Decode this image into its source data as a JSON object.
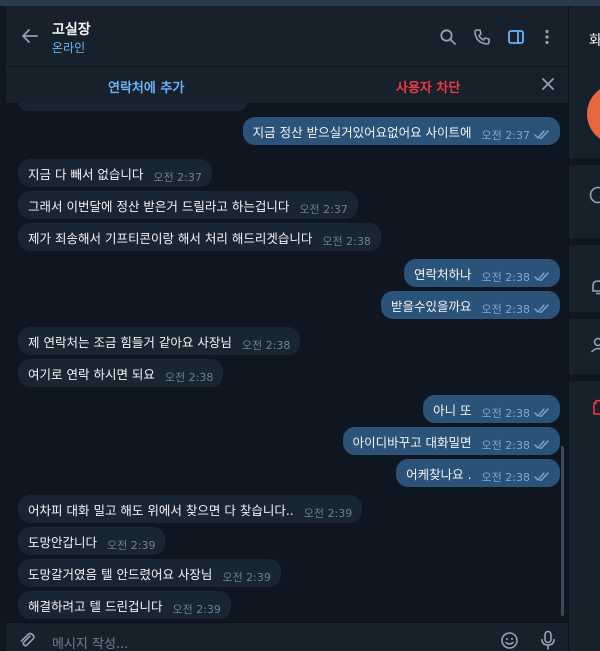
{
  "header": {
    "title": "고실장",
    "status": "온라인"
  },
  "action_bar": {
    "add_contact": "연락처에 추가",
    "block_user": "사용자 차단"
  },
  "messages": [
    {
      "dir": "out",
      "text": "지금 정산 받으실거있어요없어요 사이트에",
      "time": "오전 2:37",
      "read": true
    },
    {
      "dir": "in",
      "text": "지금 다 빼서 없습니다",
      "time": "오전 2:37"
    },
    {
      "dir": "in",
      "text": "그래서 이번달에 정산 받은거 드릴라고 하는겁니다",
      "time": "오전 2:37"
    },
    {
      "dir": "in",
      "text": "제가 죄송해서 기프티콘이랑 해서 처리 해드리겟습니다",
      "time": "오전 2:38"
    },
    {
      "dir": "out",
      "text": "연락처하나",
      "time": "오전 2:38",
      "read": true
    },
    {
      "dir": "out",
      "text": "받을수있을까요",
      "time": "오전 2:38",
      "read": true
    },
    {
      "dir": "in",
      "text": "제 연락처는 조금 힘들거 같아요 사장님",
      "time": "오전 2:38"
    },
    {
      "dir": "in",
      "text": "여기로 연락 하시면 되요",
      "time": "오전 2:38"
    },
    {
      "dir": "out",
      "text": "아니 또",
      "time": "오전 2:38",
      "read": true
    },
    {
      "dir": "out",
      "text": "아이디바꾸고 대화밀면",
      "time": "오전 2:38",
      "read": true
    },
    {
      "dir": "out",
      "text": "어케찾나요 .",
      "time": "오전 2:38",
      "read": true
    },
    {
      "dir": "in",
      "text": "어차피 대화 밀고 해도 위에서 찾으면 다 찾습니다..",
      "time": "오전 2:39"
    },
    {
      "dir": "in",
      "text": "도망안갑니다",
      "time": "오전 2:39"
    },
    {
      "dir": "in",
      "text": "도망갈거였음 텔 안드렸어요 사장님",
      "time": "오전 2:39"
    },
    {
      "dir": "in",
      "text": "해결하려고 텔 드린겁니다",
      "time": "오전 2:39"
    }
  ],
  "input": {
    "placeholder": "메시지 작성..."
  },
  "side_panel": {
    "title_fragment": "화"
  },
  "colors": {
    "background": "#0e1621",
    "panel": "#17212b",
    "bubble_in": "#182533",
    "bubble_out": "#2b5278",
    "accent": "#6ab3f3",
    "danger": "#ec3942",
    "avatar": "#e8673f"
  },
  "icons": {
    "back": "arrow-left-icon",
    "search": "search-icon",
    "call": "phone-icon",
    "sidebar": "sidebar-toggle-icon",
    "more": "more-vertical-icon",
    "close": "close-icon",
    "attach": "paperclip-icon",
    "emoji": "emoji-icon",
    "mic": "microphone-icon"
  }
}
